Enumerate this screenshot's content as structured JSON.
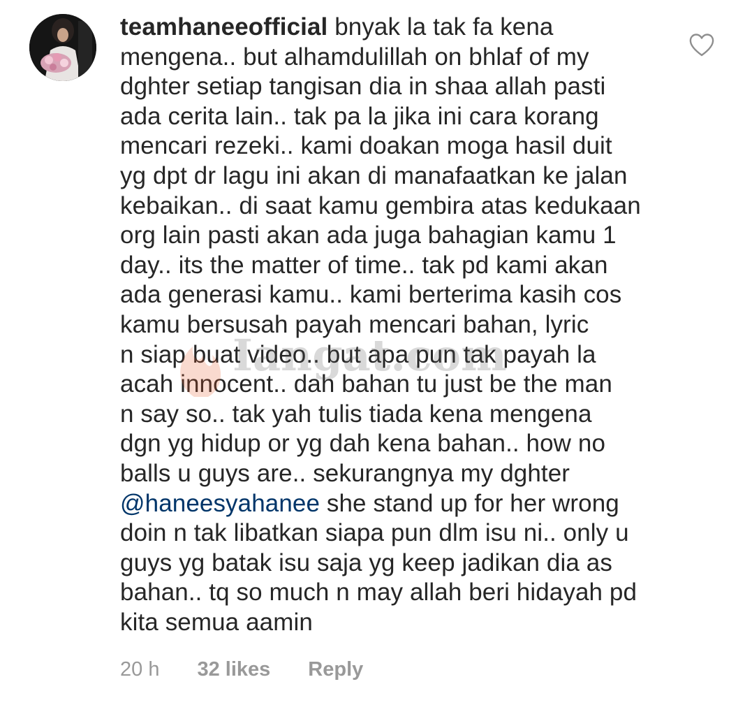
{
  "comment": {
    "username": "teamhaneeofficial",
    "lines": [
      [
        {
          "t": "bnyak la tak fa kena"
        }
      ],
      [
        {
          "t": "mengena.. but alhamdulillah on bhlaf of my"
        }
      ],
      [
        {
          "t": "dghter setiap tangisan dia in shaa allah pasti"
        }
      ],
      [
        {
          "t": "ada cerita lain.. tak pa la jika ini cara korang"
        }
      ],
      [
        {
          "t": "mencari rezeki.. kami doakan moga hasil duit"
        }
      ],
      [
        {
          "t": "yg dpt dr lagu ini akan di manafaatkan ke jalan"
        }
      ],
      [
        {
          "t": "kebaikan.. di saat kamu gembira atas kedukaan"
        }
      ],
      [
        {
          "t": "org lain pasti akan ada juga bahagian kamu 1"
        }
      ],
      [
        {
          "t": "day.. its the matter of time.. tak pd kami akan"
        }
      ],
      [
        {
          "t": "ada generasi kamu.. kami berterima kasih cos"
        }
      ],
      [
        {
          "t": "kamu bersusah payah mencari bahan, lyric"
        }
      ],
      [
        {
          "t": "n siap buat video.. but apa pun tak payah la"
        }
      ],
      [
        {
          "t": "acah innocent.. dah bahan tu just be the man"
        }
      ],
      [
        {
          "t": "n say so.. tak yah tulis tiada kena mengena"
        }
      ],
      [
        {
          "t": "dgn yg hidup or yg dah kena bahan.. how no"
        }
      ],
      [
        {
          "t": "balls u guys are.. sekurangnya my dghter"
        }
      ],
      [
        {
          "t": "@haneesyahanee",
          "mention": true
        },
        {
          "t": " she stand up for her wrong"
        }
      ],
      [
        {
          "t": "doin n tak libatkan siapa pun dlm isu ni.. only u"
        }
      ],
      [
        {
          "t": "guys yg batak isu saja yg keep jadikan dia as"
        }
      ],
      [
        {
          "t": "bahan.. tq so much n may allah beri hidayah pd"
        }
      ],
      [
        {
          "t": "kita semua aamin"
        }
      ]
    ],
    "time": "20 h",
    "likes": "32 likes",
    "reply_label": "Reply"
  },
  "icons": {
    "like": "heart-outline-icon",
    "avatar": "profile-photo"
  },
  "watermark": {
    "text": "Iangat.com"
  },
  "colors": {
    "text": "#262626",
    "mention": "#003569",
    "meta": "#999999",
    "icon": "#8e8e8e",
    "background": "#ffffff"
  }
}
